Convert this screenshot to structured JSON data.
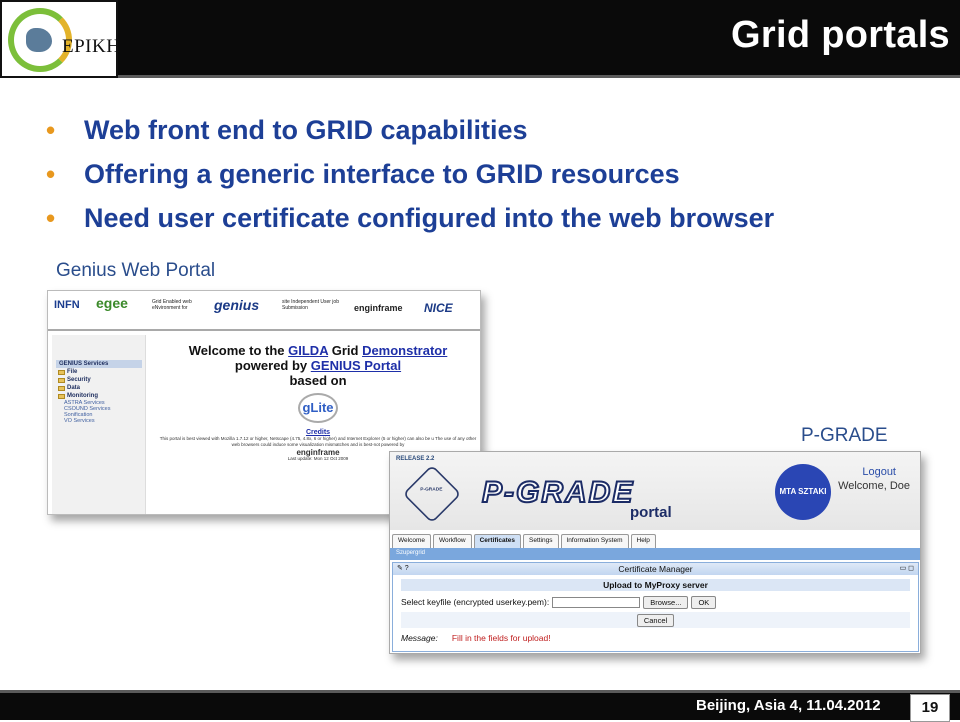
{
  "header": {
    "title": "Grid portals",
    "logo_text": "EPIKH"
  },
  "bullets": [
    "Web front end to GRID capabilities",
    "Offering a generic interface to GRID resources",
    "Need user certificate configured into the web browser"
  ],
  "colors": {
    "title_text": "#ffffff",
    "header_bg": "#0a0a0a",
    "bullet_text": "#1d3f96",
    "bullet_marker": "#e8981e",
    "caption": "#2a4d8c"
  },
  "genius": {
    "caption": "Genius Web Portal",
    "logos": [
      "INFN",
      "egee",
      "Grid Enabled web eNvironment for",
      "genius",
      "site Independent User job Submission",
      "enginframe",
      "NICE"
    ],
    "sidebar": {
      "header": "GENIUS Services",
      "items": [
        "File",
        "Security",
        "Data",
        "Monitoring"
      ],
      "subitems": [
        "ASTRA Services",
        "CSOUND Services",
        "Sonification",
        "VO Services"
      ]
    },
    "welcome_line1_pre": "Welcome to the ",
    "welcome_gilda": "GILDA",
    "welcome_grid": " Grid ",
    "welcome_demonstrator": "Demonstrator",
    "welcome_line2_pre": "powered by ",
    "welcome_portal": "GENIUS Portal",
    "welcome_line3": "based on",
    "glite": "gLite",
    "credits": "Credits",
    "small_text": "This portal is best viewed with Mozilla 1.7.12 or higher, Netscape (4.75, 4.8x, 6 or higher) and Internet Explorer (5 or higher) can also be u The use of any other web browsers could induce some visualization mismatches and is best-not powered by",
    "enginframe": "enginframe",
    "last_update": "Last update: Mon 12 Oct 2009"
  },
  "pgrade": {
    "caption": "P-GRADE",
    "release": "RELEASE 2.2",
    "logo": "P-GRADE",
    "logo_sub": "portal",
    "mta": "MTA SZTAKI",
    "logout": "Logout",
    "welcome": "Welcome, Doe",
    "tabs": [
      "Welcome",
      "Workflow",
      "Certificates",
      "Settings",
      "Information System",
      "Help"
    ],
    "active_tab": "Certificates",
    "bar_label": "Szupergrid",
    "panel_title": "Certificate Manager",
    "upload_title": "Upload to MyProxy server",
    "keyfile_label": "Select keyfile (encrypted userkey.pem):",
    "browse_button": "Browse...",
    "ok_button": "OK",
    "cancel_button": "Cancel",
    "message_label": "Message:",
    "message_value": "Fill in the fields for upload!"
  },
  "footer": {
    "text": "Beijing, Asia 4, 11.04.2012",
    "page": "19"
  }
}
